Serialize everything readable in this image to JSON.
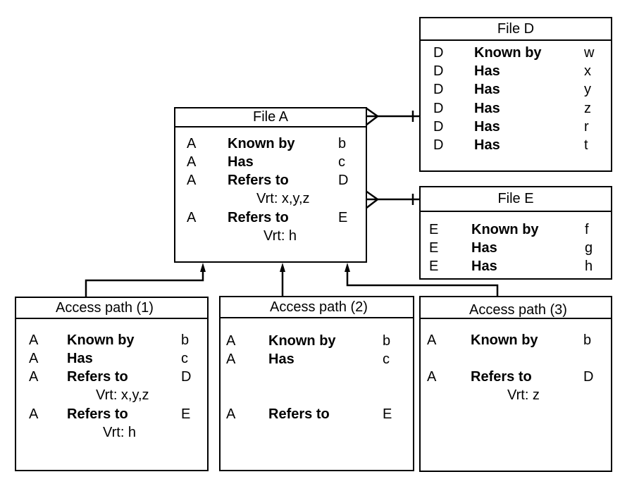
{
  "boxes": {
    "fileA": {
      "title": "File A",
      "rows": [
        {
          "subject": "A",
          "relation": "Known by",
          "object": "b"
        },
        {
          "subject": "A",
          "relation": "Has",
          "object": "c"
        },
        {
          "subject": "A",
          "relation": "Refers to",
          "object": "D",
          "vrt": "Vrt: x,y,z"
        },
        {
          "subject": "A",
          "relation": "Refers to",
          "object": "E",
          "vrt": "Vrt: h"
        }
      ]
    },
    "fileD": {
      "title": "File D",
      "rows": [
        {
          "subject": "D",
          "relation": "Known by",
          "object": "w"
        },
        {
          "subject": "D",
          "relation": "Has",
          "object": "x"
        },
        {
          "subject": "D",
          "relation": "Has",
          "object": "y"
        },
        {
          "subject": "D",
          "relation": "Has",
          "object": "z"
        },
        {
          "subject": "D",
          "relation": "Has",
          "object": "r"
        },
        {
          "subject": "D",
          "relation": "Has",
          "object": "t"
        }
      ]
    },
    "fileE": {
      "title": "File E",
      "rows": [
        {
          "subject": "E",
          "relation": "Known by",
          "object": "f"
        },
        {
          "subject": "E",
          "relation": "Has",
          "object": "g"
        },
        {
          "subject": "E",
          "relation": "Has",
          "object": "h"
        }
      ]
    },
    "ap1": {
      "title": "Access path (1)",
      "rows": [
        {
          "subject": "A",
          "relation": "Known by",
          "object": "b"
        },
        {
          "subject": "A",
          "relation": "Has",
          "object": "c"
        },
        {
          "subject": "A",
          "relation": "Refers to",
          "object": "D",
          "vrt": "Vrt: x,y,z"
        },
        {
          "subject": "A",
          "relation": "Refers to",
          "object": "E",
          "vrt": "Vrt: h"
        }
      ]
    },
    "ap2": {
      "title": "Access path (2)",
      "rows": [
        {
          "subject": "A",
          "relation": "Known by",
          "object": "b"
        },
        {
          "subject": "A",
          "relation": "Has",
          "object": "c"
        },
        {
          "subject": "A",
          "relation": "Refers to",
          "object": "E"
        }
      ]
    },
    "ap3": {
      "title": "Access path (3)",
      "rows": [
        {
          "subject": "A",
          "relation": "Known by",
          "object": "b"
        },
        {
          "subject": "A",
          "relation": "Refers to",
          "object": "D",
          "vrt": "Vrt: z"
        }
      ]
    }
  },
  "relationships": [
    {
      "from": "File A",
      "to": "File D",
      "type": "many-to-one"
    },
    {
      "from": "File A",
      "to": "File E",
      "type": "many-to-one"
    },
    {
      "from": "Access path (1)",
      "to": "File A",
      "type": "arrow"
    },
    {
      "from": "Access path (2)",
      "to": "File A",
      "type": "arrow"
    },
    {
      "from": "Access path (3)",
      "to": "File A",
      "type": "arrow"
    }
  ]
}
